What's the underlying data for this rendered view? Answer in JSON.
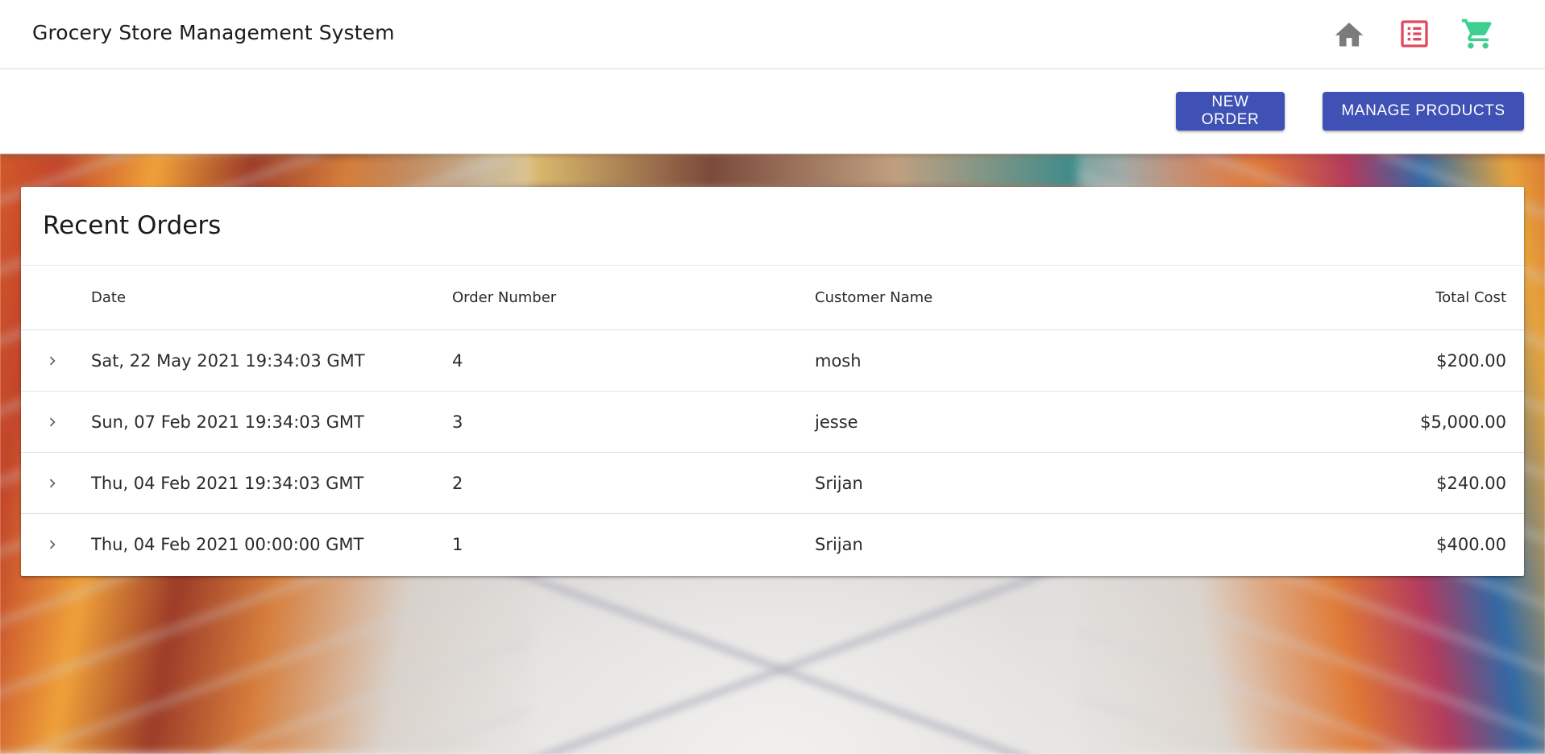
{
  "app": {
    "title": "Grocery Store Management System"
  },
  "nav": {
    "icons": [
      {
        "name": "home-icon",
        "color": "#7b7b7b"
      },
      {
        "name": "list-icon",
        "color": "#e04a5f"
      },
      {
        "name": "cart-icon",
        "color": "#3ccf8e"
      }
    ]
  },
  "actions": {
    "new_order_label": "NEW ORDER",
    "manage_products_label": "MANAGE PRODUCTS",
    "button_color": "#3f51b5"
  },
  "orders": {
    "title": "Recent Orders",
    "columns": {
      "date": "Date",
      "order_number": "Order Number",
      "customer_name": "Customer Name",
      "total_cost": "Total Cost"
    },
    "rows": [
      {
        "date": "Sat, 22 May 2021 19:34:03 GMT",
        "order_number": "4",
        "customer_name": "mosh",
        "total_cost": "$200.00"
      },
      {
        "date": "Sun, 07 Feb 2021 19:34:03 GMT",
        "order_number": "3",
        "customer_name": "jesse",
        "total_cost": "$5,000.00"
      },
      {
        "date": "Thu, 04 Feb 2021 19:34:03 GMT",
        "order_number": "2",
        "customer_name": "Srijan",
        "total_cost": "$240.00"
      },
      {
        "date": "Thu, 04 Feb 2021 00:00:00 GMT",
        "order_number": "1",
        "customer_name": "Srijan",
        "total_cost": "$400.00"
      }
    ]
  }
}
